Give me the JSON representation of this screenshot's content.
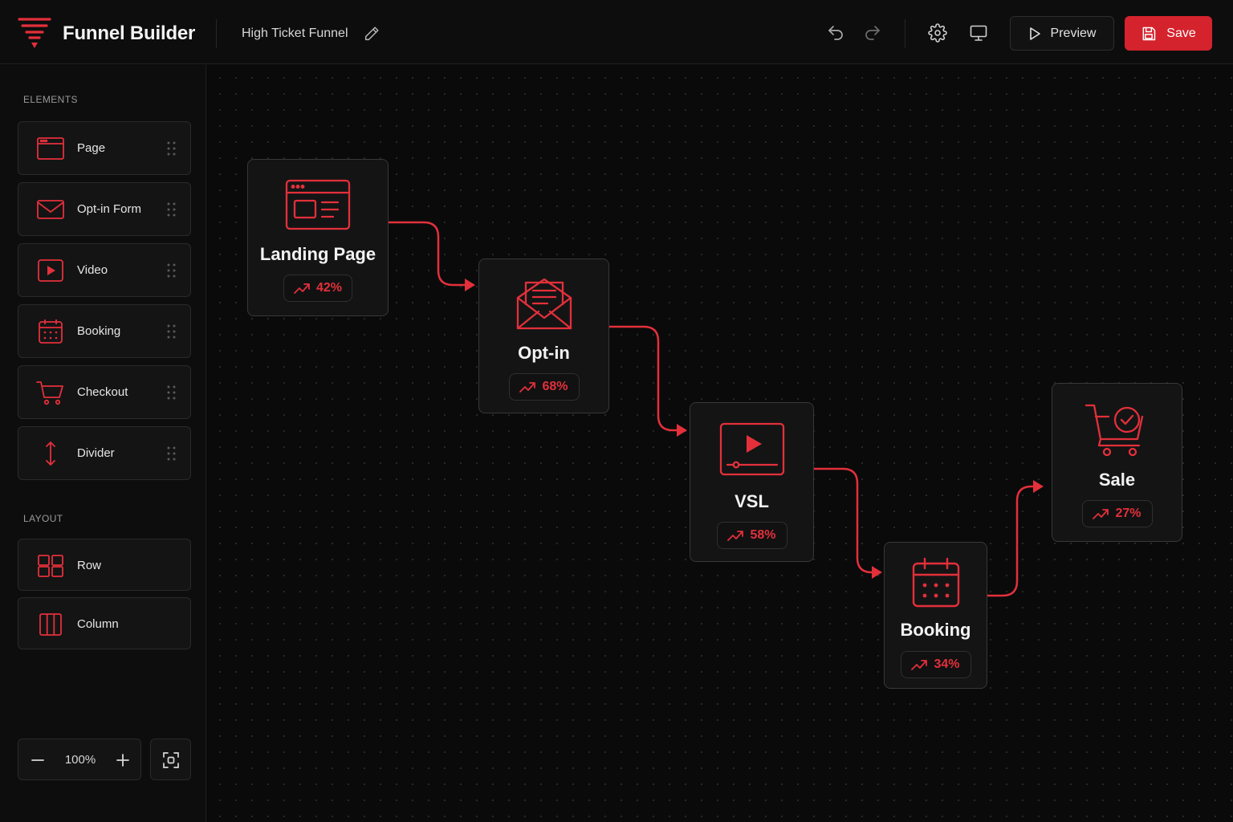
{
  "app": {
    "title": "Funnel Builder",
    "funnel_name": "High Ticket Funnel"
  },
  "toolbar": {
    "preview_label": "Preview",
    "save_label": "Save"
  },
  "colors": {
    "accent": "#e3303a",
    "save_bg": "#d4232d",
    "background": "#0a0a0b",
    "panel": "#0d0d0e",
    "card": "#141415"
  },
  "sidebar": {
    "elements_label": "ELEMENTS",
    "elements": [
      {
        "label": "Page",
        "icon": "browser-page-icon"
      },
      {
        "label": "Opt-in Form",
        "icon": "envelope-icon"
      },
      {
        "label": "Video",
        "icon": "video-play-icon"
      },
      {
        "label": "Booking",
        "icon": "calendar-icon"
      },
      {
        "label": "Checkout",
        "icon": "cart-icon"
      },
      {
        "label": "Divider",
        "icon": "vertical-arrows-icon"
      }
    ],
    "layout_label": "LAYOUT",
    "layout": [
      {
        "label": "Row",
        "icon": "row-layout-icon"
      },
      {
        "label": "Column",
        "icon": "column-layout-icon"
      }
    ],
    "zoom": "100%"
  },
  "nodes": [
    {
      "title": "Landing Page",
      "rate": "42%",
      "icon": "landing-page-icon"
    },
    {
      "title": "Opt-in",
      "rate": "68%",
      "icon": "mail-open-icon"
    },
    {
      "title": "VSL",
      "rate": "58%",
      "icon": "video-player-icon"
    },
    {
      "title": "Booking",
      "rate": "34%",
      "icon": "calendar-icon"
    },
    {
      "title": "Sale",
      "rate": "27%",
      "icon": "cart-check-icon"
    }
  ]
}
